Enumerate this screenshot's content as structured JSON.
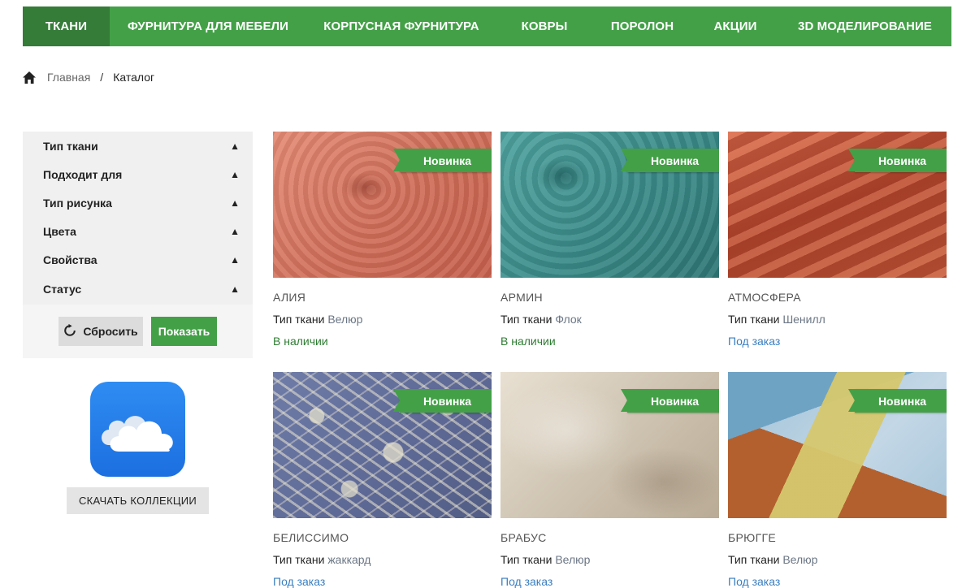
{
  "nav": {
    "items": [
      {
        "label": "ТКАНИ",
        "active": true
      },
      {
        "label": "ФУРНИТУРА ДЛЯ МЕБЕЛИ",
        "active": false
      },
      {
        "label": "КОРПУСНАЯ ФУРНИТУРА",
        "active": false
      },
      {
        "label": "КОВРЫ",
        "active": false
      },
      {
        "label": "ПОРОЛОН",
        "active": false
      },
      {
        "label": "АКЦИИ",
        "active": false
      },
      {
        "label": "3D МОДЕЛИРОВАНИЕ",
        "active": false
      }
    ],
    "bg_color": "#43a047",
    "active_color": "#357c39"
  },
  "breadcrumb": {
    "home_icon": "home-icon",
    "items": [
      "Главная",
      "Каталог"
    ],
    "separator": "/"
  },
  "filters": {
    "groups": [
      "Тип ткани",
      "Подходит для",
      "Тип рисунка",
      "Цвета",
      "Свойства",
      "Статус"
    ],
    "toggle_glyph": "▲",
    "reset_label": "Сбросить",
    "reset_icon": "refresh-icon",
    "show_label": "Показать"
  },
  "download": {
    "icon": "cloud-icon",
    "label": "СКАЧАТЬ КОЛЛЕКЦИИ"
  },
  "products": [
    {
      "name": "АЛИЯ",
      "type_label": "Тип ткани",
      "type_value": "Велюр",
      "status": "В наличии",
      "badge": "Новинка"
    },
    {
      "name": "АРМИН",
      "type_label": "Тип ткани",
      "type_value": "Флок",
      "status": "В наличии",
      "badge": "Новинка"
    },
    {
      "name": "АТМОСФЕРА",
      "type_label": "Тип ткани",
      "type_value": "Шенилл",
      "status": "Под заказ",
      "badge": "Новинка"
    },
    {
      "name": "БЕЛИССИМО",
      "type_label": "Тип ткани",
      "type_value": "жаккард",
      "status": "Под заказ",
      "badge": "Новинка"
    },
    {
      "name": "БРАБУС",
      "type_label": "Тип ткани",
      "type_value": "Велюр",
      "status": "Под заказ",
      "badge": "Новинка"
    },
    {
      "name": "БРЮГГЕ",
      "type_label": "Тип ткани",
      "type_value": "Велюр",
      "status": "Под заказ",
      "badge": "Новинка"
    }
  ],
  "colors": {
    "accent_green": "#43a047",
    "in_stock": "#2e7d32",
    "on_order": "#3a7fc0"
  }
}
